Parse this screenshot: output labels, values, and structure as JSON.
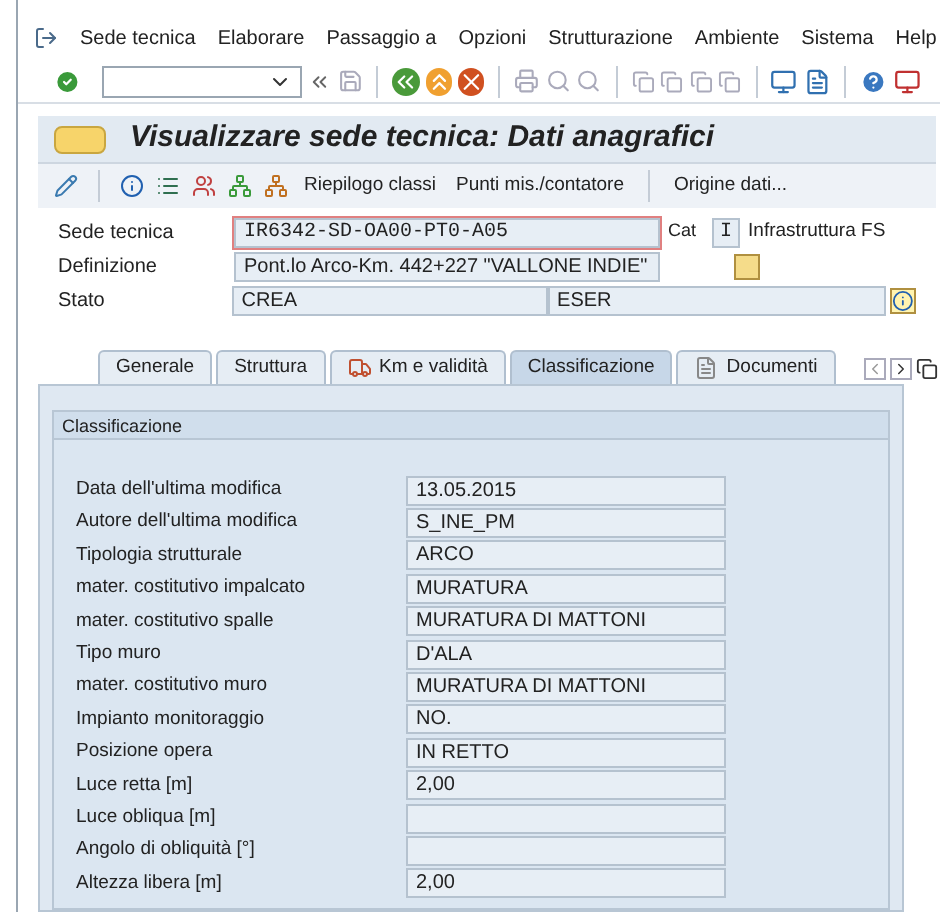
{
  "menu_bar": {
    "items": [
      "Sede tecnica",
      "Elaborare",
      "Passaggio a",
      "Opzioni",
      "Strutturazione",
      "Ambiente",
      "Sistema",
      "Help"
    ]
  },
  "title": "Visualizzare sede tecnica: Dati anagrafici",
  "app_toolbar": {
    "buttons": [
      "Riepilogo classi",
      "Punti mis./contatore",
      "Origine dati..."
    ]
  },
  "header": {
    "sede_tecnica": {
      "label": "Sede tecnica",
      "value": "IR6342-SD-OA00-PT0-A05"
    },
    "cat": {
      "label": "Cat",
      "value": "I",
      "text": "Infrastruttura FS"
    },
    "definizione": {
      "label": "Definizione",
      "value": "Pont.lo Arco-Km. 442+227 \"VALLONE INDIE\""
    },
    "stato": {
      "label": "Stato",
      "value": "CREA",
      "value_2": "ESER"
    }
  },
  "tabs": [
    {
      "label": "Generale",
      "selected": false,
      "kind": "plain"
    },
    {
      "label": "Struttura",
      "selected": false,
      "kind": "plain"
    },
    {
      "label": "Km e validità",
      "selected": false,
      "kind": "track"
    },
    {
      "label": "Classificazione",
      "selected": true,
      "kind": "plain"
    },
    {
      "label": "Documenti",
      "selected": false,
      "kind": "doc"
    }
  ],
  "group": {
    "title": "Classificazione",
    "rows": [
      {
        "label": "Data dell'ultima modifica",
        "value": "13.05.2015"
      },
      {
        "label": "Autore dell'ultima modifica",
        "value": "S_INE_PM"
      },
      {
        "label": "Tipologia strutturale",
        "value": "ARCO"
      },
      {
        "label": "mater. costitutivo impalcato",
        "value": "MURATURA"
      },
      {
        "label": "mater. costitutivo spalle",
        "value": "MURATURA DI MATTONI"
      },
      {
        "label": "Tipo muro",
        "value": "D'ALA"
      },
      {
        "label": "mater. costitutivo muro",
        "value": "MURATURA DI MATTONI"
      },
      {
        "label": "Impianto monitoraggio",
        "value": "NO."
      },
      {
        "label": "Posizione opera",
        "value": "IN RETTO"
      },
      {
        "label": "Luce retta [m]",
        "value": "2,00"
      },
      {
        "label": "Luce obliqua [m]"
      },
      {
        "label": "Angolo di obliquità [°]"
      },
      {
        "label": "Altezza libera [m]",
        "value": "2,00"
      }
    ]
  }
}
